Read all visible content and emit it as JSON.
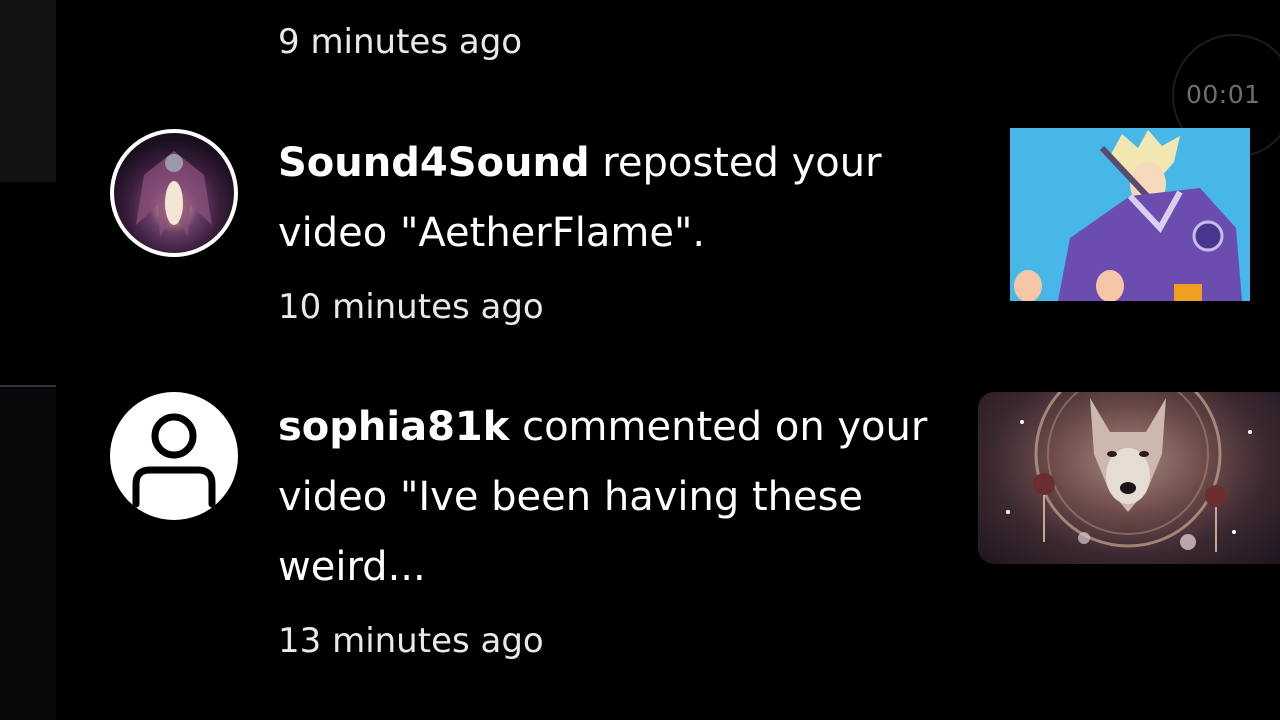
{
  "timer": {
    "label": "00:01"
  },
  "top_fragment": {
    "time": "9 minutes ago"
  },
  "notifications": [
    {
      "username": "Sound4Sound",
      "action": " reposted your video \"AetherFlame\".",
      "time": "10 minutes ago",
      "avatar_icon": "custom-art-avatar",
      "thumbnail_icon": "anime-character-thumbnail"
    },
    {
      "username": "sophia81k",
      "action": " commented on your video \"Ive been having these weird...",
      "time": "13 minutes ago",
      "avatar_icon": "default-user-icon",
      "thumbnail_icon": "wolf-dreamcatcher-thumbnail"
    }
  ],
  "colors": {
    "background": "#000000",
    "text": "#ffffff",
    "muted": "#6e6e6e",
    "thumbnail_sky": "#47b7e8"
  }
}
